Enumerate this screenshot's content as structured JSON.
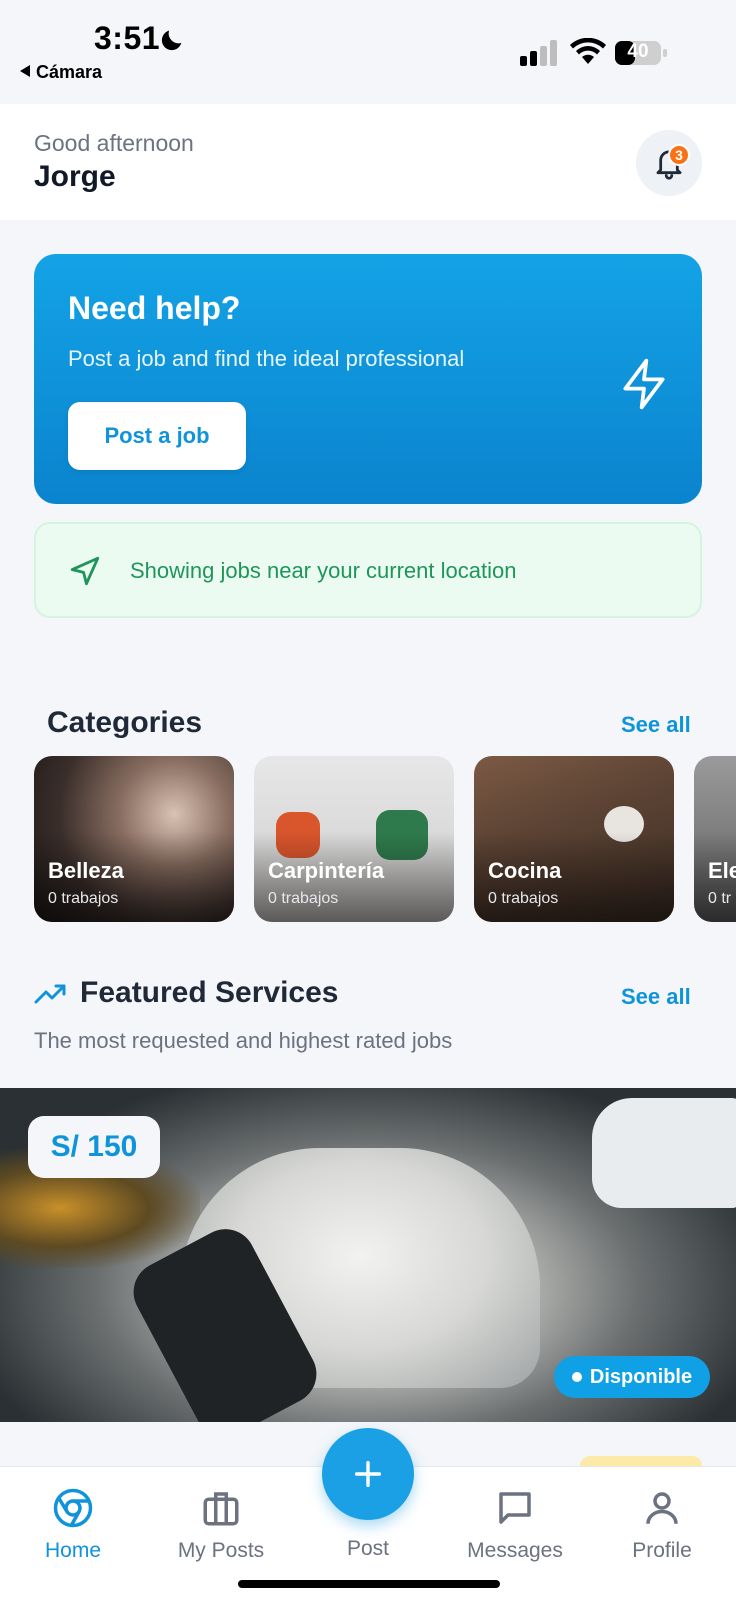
{
  "status_bar": {
    "time": "3:51",
    "back_label": "Cámara",
    "battery": "40"
  },
  "header": {
    "greeting": "Good afternoon",
    "name": "Jorge",
    "notification_count": "3"
  },
  "hero": {
    "title": "Need help?",
    "subtitle": "Post a job and find the ideal professional",
    "button_label": "Post a job"
  },
  "location_banner": {
    "text": "Showing jobs near your current location"
  },
  "categories": {
    "title": "Categories",
    "see_all": "See all",
    "items": [
      {
        "name": "Belleza",
        "count": "0 trabajos"
      },
      {
        "name": "Carpintería",
        "count": "0 trabajos"
      },
      {
        "name": "Cocina",
        "count": "0 trabajos"
      },
      {
        "name": "Ele",
        "count": "0 tr"
      }
    ]
  },
  "featured": {
    "title": "Featured Services",
    "see_all": "See all",
    "subtitle": "The most requested and highest rated jobs",
    "card": {
      "price": "S/ 150",
      "status": "Disponible"
    }
  },
  "tabbar": {
    "home": "Home",
    "my_posts": "My Posts",
    "post": "Post",
    "messages": "Messages",
    "profile": "Profile"
  },
  "colors": {
    "accent": "#0f94dc",
    "success": "#1f9659",
    "badge": "#f97316"
  }
}
